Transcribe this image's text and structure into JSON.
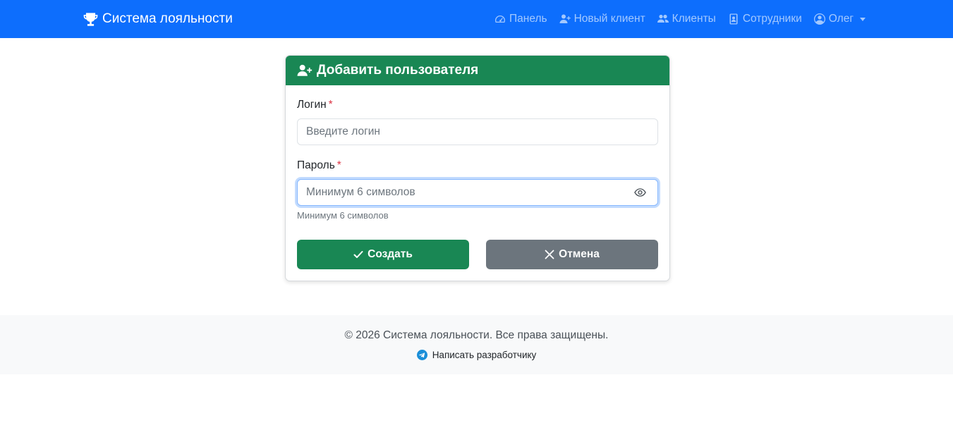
{
  "navbar": {
    "brand": "Система лояльности",
    "links": {
      "dashboard": "Панель",
      "new_client": "Новый клиент",
      "clients": "Клиенты",
      "employees": "Сотрудники",
      "user": "Олег"
    },
    "icons": {
      "brand": "trophy-icon",
      "dashboard": "speedometer-icon",
      "new_client": "person-plus-icon",
      "clients": "people-icon",
      "employees": "badge-icon",
      "user": "person-circle-icon"
    }
  },
  "form": {
    "title": "Добавить пользователя",
    "title_icon": "person-plus-icon",
    "login_label": "Логин",
    "required_mark": "*",
    "login_value": "",
    "login_placeholder": "Введите логин",
    "password_label": "Пароль",
    "password_value": "",
    "password_placeholder": "Минимум 6 символов",
    "password_hint": "Минимум 6 символов",
    "create_label": "Создать",
    "cancel_label": "Отмена"
  },
  "footer": {
    "copyright": "© 2026 Система лояльности. Все права защищены.",
    "dev_link": "Написать разработчику",
    "dev_icon": "telegram-icon"
  },
  "colors": {
    "primary": "#0d6efd",
    "success": "#198754",
    "secondary": "#6c757d",
    "danger": "#dc3545",
    "footer_bg": "#f8f9fa"
  }
}
